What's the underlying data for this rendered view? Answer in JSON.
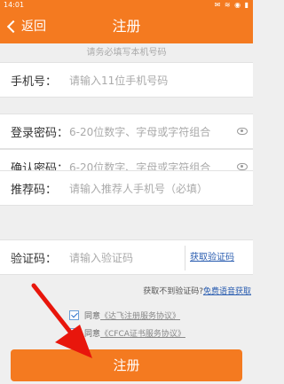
{
  "status_bar": {
    "time": "14:01",
    "icons": "✉ ≋ ◉ ▮"
  },
  "header": {
    "back_label": "返回",
    "title": "注册"
  },
  "hint": "请务必填写本机号码",
  "form": {
    "phone": {
      "label": "手机号：",
      "placeholder": "请输入11位手机号码"
    },
    "password": {
      "label": "登录密码：",
      "placeholder": "6-20位数字、字母或字符组合"
    },
    "confirm": {
      "label": "确认密码：",
      "placeholder": "6-20位数字、字母或字符组合"
    },
    "referrer": {
      "label": "推荐码：",
      "placeholder": "请输入推荐人手机号（必填）"
    },
    "code": {
      "label": "验证码：",
      "placeholder": "请输入验证码",
      "get_code": "获取验证码"
    }
  },
  "voice": {
    "prefix": "获取不到验证码?",
    "link": "免费语音获取"
  },
  "agreements": [
    {
      "prefix": "同意",
      "doc": "《达飞注册服务协议》",
      "checked": true
    },
    {
      "prefix": "同意",
      "doc": "《CFCA证书服务协议》",
      "checked": true
    }
  ],
  "submit_label": "注册",
  "colors": {
    "accent": "#f47a20",
    "link": "#2a5db0",
    "arrow": "#e8160c"
  },
  "icons": {
    "back": "chevron-left-icon",
    "eye": "eye-icon",
    "check": "checkbox-icon",
    "annotation": "red-arrow-icon"
  }
}
